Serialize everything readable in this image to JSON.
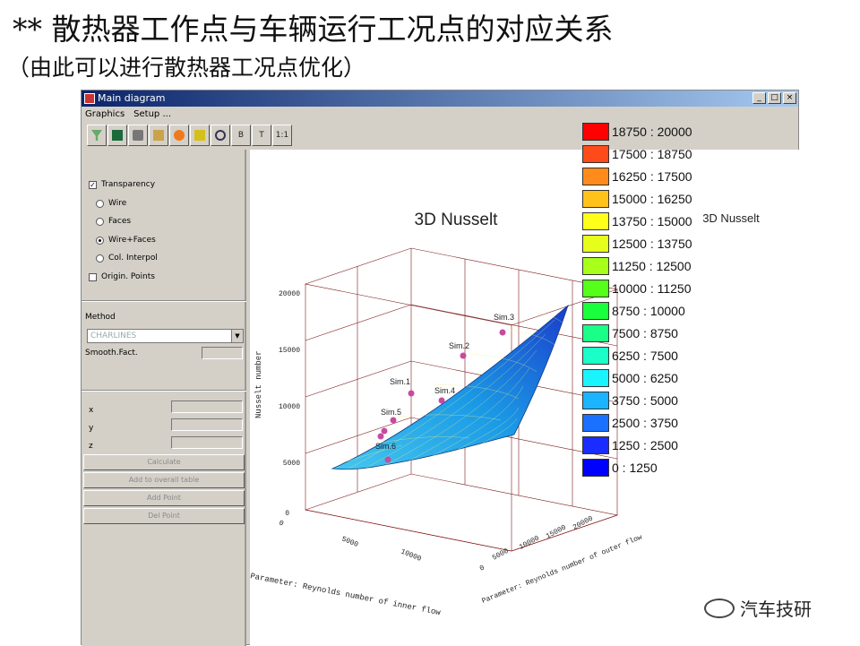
{
  "slide": {
    "title": "** 散热器工作点与车辆运行工况点的对应关系",
    "subtitle": "（由此可以进行散热器工况点优化）"
  },
  "window": {
    "title": "Main diagram",
    "controls": [
      "_",
      "□",
      "×"
    ],
    "menu": [
      "Graphics",
      "Setup ..."
    ],
    "toolbar": [
      "",
      "",
      "",
      "",
      "",
      "",
      "",
      "B",
      "T",
      "1:1"
    ]
  },
  "left_panel": {
    "transparency": "Transparency",
    "modes": [
      "Wire",
      "Faces",
      "Wire+Faces",
      "Col. Interpol"
    ],
    "selected_mode": "Wire+Faces",
    "origin_points": "Origin. Points",
    "method_label": "Method",
    "method_value": "CHARLINES",
    "smooth_label": "Smooth.Fact.",
    "axes": [
      "x",
      "y",
      "z"
    ],
    "buttons": [
      "Calculate",
      "Add to overall table",
      "Add Point",
      "Del Point"
    ]
  },
  "plot": {
    "title": "3D Nusselt",
    "corner_label": "3D Nusselt",
    "z_label": "Nusselt number",
    "z_ticks": [
      "20000",
      "15000",
      "10000",
      "5000",
      "0"
    ],
    "x_label": "Parameter: Reynolds number of inner flow",
    "x_ticks": [
      "0",
      "5000",
      "10000"
    ],
    "y_label": "Parameter: Reynolds number of outer flow",
    "y_ticks": [
      "0",
      "5000",
      "10000",
      "15000",
      "20000"
    ],
    "points": [
      "Sim.3",
      "Sim.2",
      "Sim.1",
      "Sim.4",
      "Sim.5",
      "Sim.6"
    ]
  },
  "legend": [
    {
      "label": "18750 : 20000",
      "color": "#ff0000"
    },
    {
      "label": "17500 : 18750",
      "color": "#ff4a1a"
    },
    {
      "label": "16250 : 17500",
      "color": "#ff8c1a"
    },
    {
      "label": "15000 : 16250",
      "color": "#ffc21a"
    },
    {
      "label": "13750 : 15000",
      "color": "#ffff1a"
    },
    {
      "label": "12500 : 13750",
      "color": "#e6ff1a"
    },
    {
      "label": "11250 : 12500",
      "color": "#a8ff1a"
    },
    {
      "label": "10000 : 11250",
      "color": "#55ff1a"
    },
    {
      "label": "8750 : 10000",
      "color": "#1aff3c"
    },
    {
      "label": "7500 : 8750",
      "color": "#1aff88"
    },
    {
      "label": "6250 : 7500",
      "color": "#1affc8"
    },
    {
      "label": "5000 : 6250",
      "color": "#1af4ff"
    },
    {
      "label": "3750 : 5000",
      "color": "#1ab4ff"
    },
    {
      "label": "2500 : 3750",
      "color": "#1a70ff"
    },
    {
      "label": "1250 : 2500",
      "color": "#1a2cff"
    },
    {
      "label": "0 : 1250",
      "color": "#0000ff"
    }
  ],
  "watermark": "汽车技研"
}
